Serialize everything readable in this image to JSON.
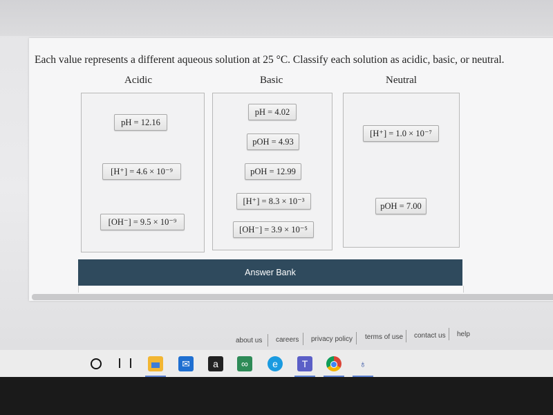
{
  "question": {
    "prompt": "Each value represents a different aqueous solution at 25 °C. Classify each solution as acidic, basic, or neutral."
  },
  "columns": {
    "acidic": {
      "label": "Acidic",
      "tiles": [
        "pH = 12.16",
        "[H⁺] = 4.6 × 10⁻⁹",
        "[OH⁻] = 9.5 × 10⁻⁹"
      ]
    },
    "basic": {
      "label": "Basic",
      "tiles": [
        "pH = 4.02",
        "pOH = 4.93",
        "pOH = 12.99",
        "[H⁺] = 8.3 × 10⁻³",
        "[OH⁻] = 3.9 × 10⁻⁵"
      ]
    },
    "neutral": {
      "label": "Neutral",
      "tiles": [
        "[H⁺] = 1.0 × 10⁻⁷",
        "pOH = 7.00"
      ]
    }
  },
  "answer_bank": {
    "label": "Answer Bank"
  },
  "footer": {
    "links": [
      "about us",
      "careers",
      "privacy policy",
      "terms of use",
      "contact us",
      "help"
    ]
  },
  "taskbar": {
    "icons": [
      "cortana-icon",
      "task-view-icon",
      "file-explorer-icon",
      "mail-icon",
      "amazon-icon",
      "tripadvisor-icon",
      "edge-icon",
      "teams-icon",
      "chrome-icon",
      "app-icon"
    ]
  }
}
